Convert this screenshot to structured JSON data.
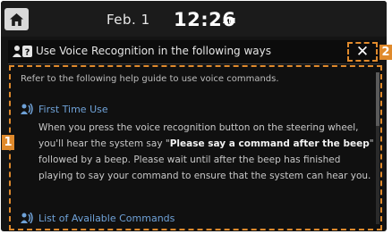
{
  "header": {
    "date": "Feb.  1",
    "time": "12:26",
    "ampm": "AM"
  },
  "dialog": {
    "title": "Use Voice Recognition in the following ways",
    "close_label": "✕",
    "intro": "Refer to the following help guide to use voice commands.",
    "sections": [
      {
        "heading": "First Time Use",
        "body_before": "When you press the voice recognition button on the steering wheel, you'll hear the system say \"",
        "body_bold": "Please say a command after the beep",
        "body_after": "\" followed by a beep. Please wait until after the beep has finished playing to say your command to ensure that the system can hear you."
      },
      {
        "heading": "List of Available Commands"
      }
    ]
  },
  "callouts": {
    "one": "1",
    "two": "2"
  },
  "colors": {
    "accent": "#e08a2c",
    "link": "#6fa2d8",
    "background": "#141414"
  },
  "icons": [
    "home-icon",
    "voice-help-icon",
    "close-icon",
    "voice-person-icon"
  ]
}
